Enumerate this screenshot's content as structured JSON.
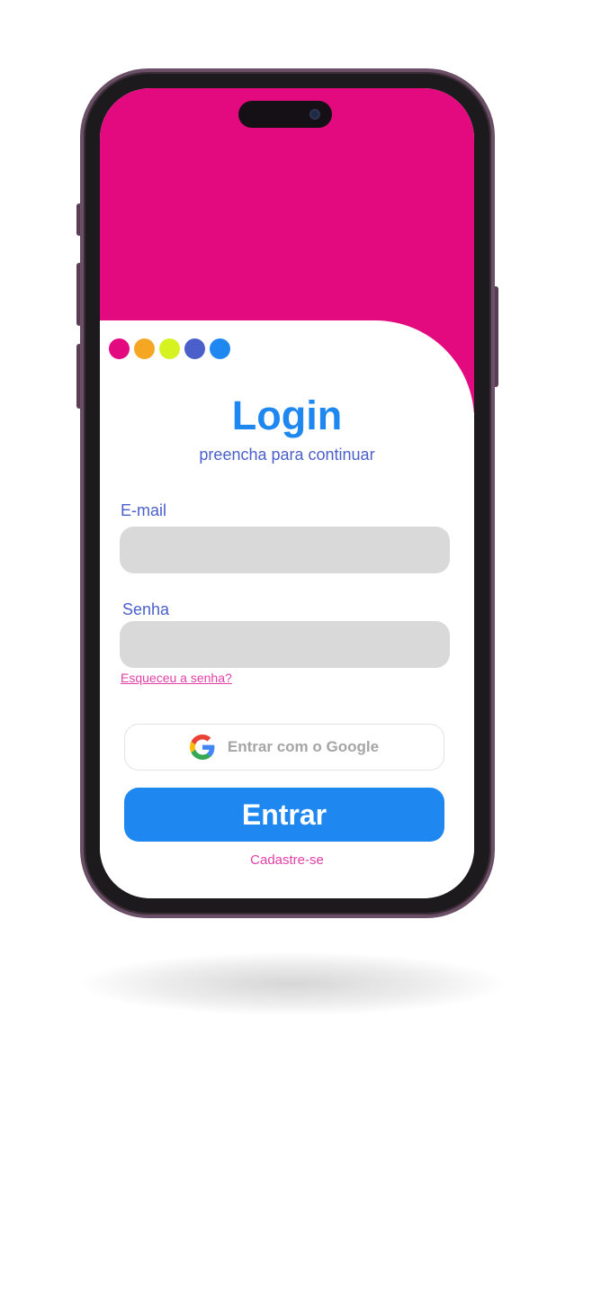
{
  "colors": {
    "hero": "#e3097f",
    "primary": "#1e88f0",
    "label": "#4a5fc9",
    "link": "#e23fa7",
    "field": "#d9d9d9"
  },
  "brand_dots": [
    {
      "icon": "magenta-dot",
      "color": "#e3097f"
    },
    {
      "icon": "orange-dot",
      "color": "#f5a623"
    },
    {
      "icon": "lime-dot",
      "color": "#d6f221"
    },
    {
      "icon": "indigo-dot",
      "color": "#4a5fc9"
    },
    {
      "icon": "blue-dot",
      "color": "#1e88f0"
    }
  ],
  "login": {
    "title": "Login",
    "subtitle": "preencha para continuar",
    "email_label": "E-mail",
    "email_value": "",
    "password_label": "Senha",
    "password_value": "",
    "forgot_link": "Esqueceu a senha?",
    "google_button": "Entrar com o Google",
    "google_icon": "google-icon",
    "submit_button": "Entrar",
    "signup_link": "Cadastre-se"
  }
}
